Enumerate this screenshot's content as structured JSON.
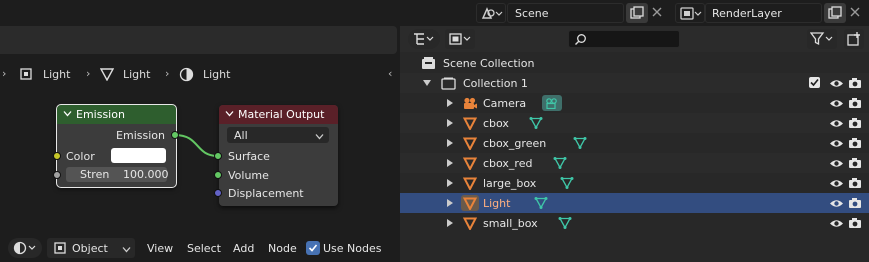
{
  "topbar": {
    "scene_label": "Scene",
    "renderlayer_label": "RenderLayer"
  },
  "node_editor": {
    "breadcrumb": [
      "Light",
      "Light",
      "Light"
    ],
    "nodes": {
      "emission": {
        "title": "Emission",
        "output_label": "Emission",
        "color_label": "Color",
        "strength_label": "Stren",
        "strength_value": "100.000"
      },
      "material_output": {
        "title": "Material Output",
        "target": "All",
        "surface_label": "Surface",
        "volume_label": "Volume",
        "displacement_label": "Displacement"
      }
    },
    "footer": {
      "mode": "Object",
      "menu": [
        "View",
        "Select",
        "Add",
        "Node"
      ],
      "use_nodes_label": "Use Nodes",
      "use_nodes_checked": true
    }
  },
  "outliner": {
    "search_placeholder": "",
    "scene_collection": "Scene Collection",
    "collection": "Collection 1",
    "items": [
      {
        "name": "Camera",
        "type": "camera",
        "selected": false
      },
      {
        "name": "cbox",
        "type": "mesh",
        "selected": false
      },
      {
        "name": "cbox_green",
        "type": "mesh",
        "selected": false
      },
      {
        "name": "cbox_red",
        "type": "mesh",
        "selected": false
      },
      {
        "name": "large_box",
        "type": "mesh",
        "selected": false
      },
      {
        "name": "Light",
        "type": "mesh",
        "selected": true
      },
      {
        "name": "small_box",
        "type": "mesh",
        "selected": false
      }
    ]
  },
  "colors": {
    "emission_header": "#2e5e2e",
    "output_header": "#5a2028",
    "selected_row": "#334d80",
    "socket_green": "#63c763",
    "socket_yellow": "#c7c729",
    "socket_gray": "#a1a1a1",
    "socket_purple": "#6363c7",
    "mesh_orange": "#e8833a",
    "data_green": "#3fc7a8"
  }
}
